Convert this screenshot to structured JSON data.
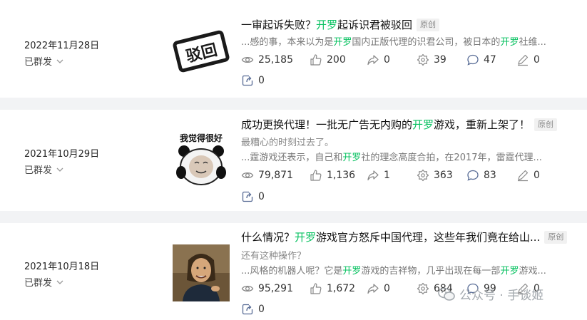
{
  "articles": [
    {
      "date": "2022年11月28日",
      "status": "已群发",
      "title_parts": [
        "一审起诉失败？",
        "开罗",
        "起诉识君被驳回"
      ],
      "tag": "原创",
      "summary_parts": [
        "...感的事，本来以为是",
        "开罗",
        "国内正版代理的识君公司，被日本的",
        "开罗",
        "社维..."
      ],
      "stats": {
        "views": "25,185",
        "likes": "200",
        "forwards": "0",
        "wow": "39",
        "comments": "47",
        "edits": "0",
        "shares": "0"
      },
      "thumb_text": "驳回"
    },
    {
      "date": "2021年10月29日",
      "status": "已群发",
      "title_parts": [
        "成功更换代理！一批无广告无内购的",
        "开罗",
        "游戏，重新上架了！"
      ],
      "tag": "原创",
      "digest": "最糟心的时刻过去了。",
      "summary_parts": [
        "...霆游戏还表示，自己和",
        "开罗",
        "社的理念高度合拍，在2017年，雷霆代理..."
      ],
      "stats": {
        "views": "79,871",
        "likes": "1,136",
        "forwards": "1",
        "wow": "363",
        "comments": "83",
        "edits": "0",
        "shares": "0"
      },
      "thumb_text": "我觉得很好"
    },
    {
      "date": "2021年10月18日",
      "status": "已群发",
      "title_parts": [
        "什么情况？",
        "开罗",
        "游戏官方怒斥中国代理，这些年我们竟在给山..."
      ],
      "tag": "原创",
      "digest": "还有这种操作？",
      "summary_parts": [
        "...风格的机器人呢？它是",
        "开罗",
        "游戏的吉祥物，几乎出现在每一部",
        "开罗",
        "游戏..."
      ],
      "stats": {
        "views": "95,291",
        "likes": "1,672",
        "forwards": "0",
        "wow": "684",
        "comments": "99",
        "edits": "0",
        "shares": "0"
      }
    }
  ],
  "watermark": "公众号 · 手谈姬",
  "colors": {
    "highlight": "#07c160",
    "background": "#f2f3f5"
  }
}
